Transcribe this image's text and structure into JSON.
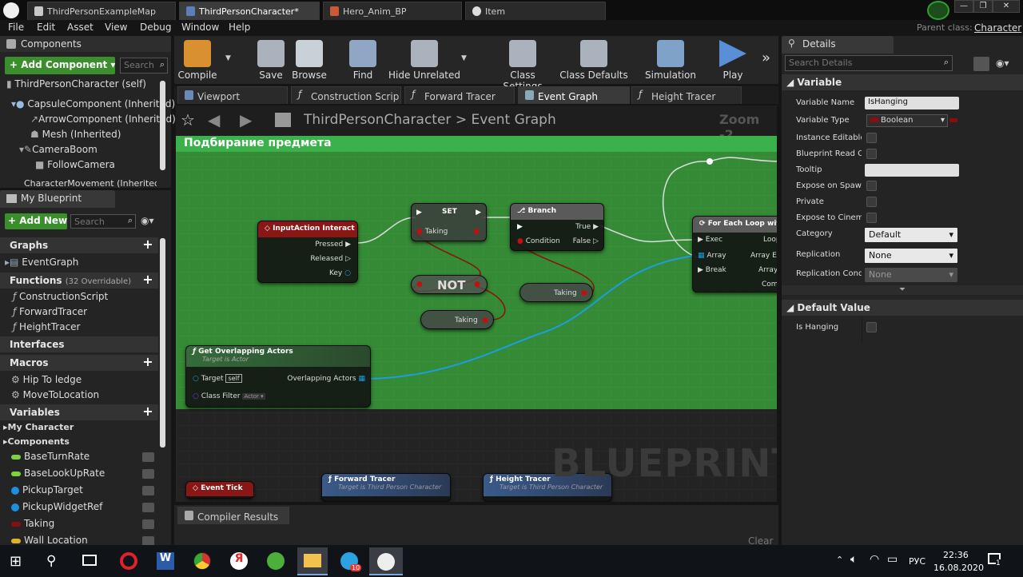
{
  "tabs": [
    {
      "label": "ThirdPersonExampleMap"
    },
    {
      "label": "ThirdPersonCharacter*"
    },
    {
      "label": "Hero_Anim_BP"
    },
    {
      "label": "Item"
    }
  ],
  "menu": [
    "File",
    "Edit",
    "Asset",
    "View",
    "Debug",
    "Window",
    "Help"
  ],
  "parent_class": {
    "label": "Parent class:",
    "value": "Character"
  },
  "components": {
    "title": "Components",
    "add_label": "+ Add Component ▾",
    "search_placeholder": "Search",
    "tree": [
      "ThirdPersonCharacter (self)",
      "CapsuleComponent (Inherited)",
      "ArrowComponent (Inherited)",
      "Mesh (Inherited)",
      "CameraBoom",
      "FollowCamera",
      "CharacterMovement (Inherited)"
    ]
  },
  "my_blueprint": {
    "title": "My Blueprint",
    "add_new": "+ Add New ▾",
    "search_placeholder": "Search",
    "sections": {
      "graphs": "Graphs",
      "functions": "Functions",
      "functions_count": "(32 Overridable)",
      "interfaces": "Interfaces",
      "macros": "Macros",
      "variables": "Variables"
    },
    "graph_items": [
      "EventGraph"
    ],
    "function_items": [
      "ConstructionScript",
      "ForwardTracer",
      "HeightTracer"
    ],
    "macro_items": [
      "Hip To ledge",
      "MoveToLocation"
    ],
    "var_groups": [
      "My Character",
      "Components"
    ],
    "variables": [
      {
        "name": "BaseTurnRate",
        "color": "#7cd33a"
      },
      {
        "name": "BaseLookUpRate",
        "color": "#7cd33a"
      },
      {
        "name": "PickupTarget",
        "color": "#1e8fe0"
      },
      {
        "name": "PickupWidgetRef",
        "color": "#1e8fe0"
      },
      {
        "name": "Taking",
        "color": "#8c0d0d"
      },
      {
        "name": "Wall Location",
        "color": "#e0b12a"
      }
    ]
  },
  "toolbar": [
    {
      "label": "Compile",
      "icon": "compile-gear-icon"
    },
    {
      "label": "Save",
      "icon": "save-disk-icon"
    },
    {
      "label": "Browse",
      "icon": "browse-magnifier-icon"
    },
    {
      "label": "Find",
      "icon": "find-binoculars-icon"
    },
    {
      "label": "Hide Unrelated",
      "icon": "hide-unrelated-icon"
    },
    {
      "label": "Class Settings",
      "icon": "class-settings-icon"
    },
    {
      "label": "Class Defaults",
      "icon": "class-defaults-icon"
    },
    {
      "label": "Simulation",
      "icon": "simulation-icon"
    },
    {
      "label": "Play",
      "icon": "play-icon"
    }
  ],
  "editor_tabs": [
    "Viewport",
    "Construction Scrip",
    "Forward Tracer",
    "Event Graph",
    "Height Tracer"
  ],
  "graph": {
    "breadcrumb_class": "ThirdPersonCharacter",
    "breadcrumb_sep": ">",
    "breadcrumb_graph": "Event Graph",
    "zoom": "Zoom -2",
    "comment": "Подбирание предмета",
    "watermark": "BLUEPRINT",
    "nodes": {
      "input_action": {
        "title": "InputAction Interact",
        "pins": [
          "Pressed",
          "Released",
          "Key"
        ]
      },
      "set": {
        "title": "SET",
        "pin": "Taking"
      },
      "branch": {
        "title": "Branch",
        "pins_in": [
          "Condition"
        ],
        "pins_out": [
          "True",
          "False"
        ]
      },
      "not": {
        "title": "NOT"
      },
      "taking_get_1": {
        "title": "Taking"
      },
      "taking_get_2": {
        "title": "Taking"
      },
      "foreach": {
        "title": "For Each Loop with",
        "pins_in": [
          "Exec",
          "Array",
          "Break"
        ],
        "pins_out": [
          "Loop",
          "Array Ele",
          "Array",
          "Comp"
        ]
      },
      "get_overlapping": {
        "title": "Get Overlapping Actors",
        "subtitle": "Target is Actor",
        "pins": [
          "Target",
          "self",
          "Class Filter",
          "Actor ▾",
          "Overlapping Actors"
        ]
      },
      "event_tick": {
        "title": "Event Tick"
      },
      "forward_tracer": {
        "title": "Forward Tracer",
        "subtitle": "Target is Third Person Character"
      },
      "height_tracer": {
        "title": "Height Tracer",
        "subtitle": "Target is Third Person Character"
      }
    }
  },
  "compiler": {
    "tab": "Compiler Results",
    "clear": "Clear"
  },
  "details": {
    "title": "Details",
    "search_placeholder": "Search Details",
    "section_variable": "Variable",
    "rows": [
      {
        "label": "Variable Name",
        "value": "IsHanging"
      },
      {
        "label": "Variable Type",
        "value": "Boolean"
      },
      {
        "label": "Instance Editable"
      },
      {
        "label": "Blueprint Read Or"
      },
      {
        "label": "Tooltip",
        "value": ""
      },
      {
        "label": "Expose on Spawn"
      },
      {
        "label": "Private"
      },
      {
        "label": "Expose to Cinema"
      },
      {
        "label": "Category",
        "value": "Default"
      },
      {
        "label": "Replication",
        "value": "None"
      },
      {
        "label": "Replication Condi",
        "value": "None"
      }
    ],
    "section_default": "Default Value",
    "default_row": {
      "label": "Is Hanging"
    }
  },
  "taskbar": {
    "lang": "РУС",
    "time": "22:36",
    "date": "16.08.2020",
    "telegram_badge": "10",
    "notif": "1"
  }
}
